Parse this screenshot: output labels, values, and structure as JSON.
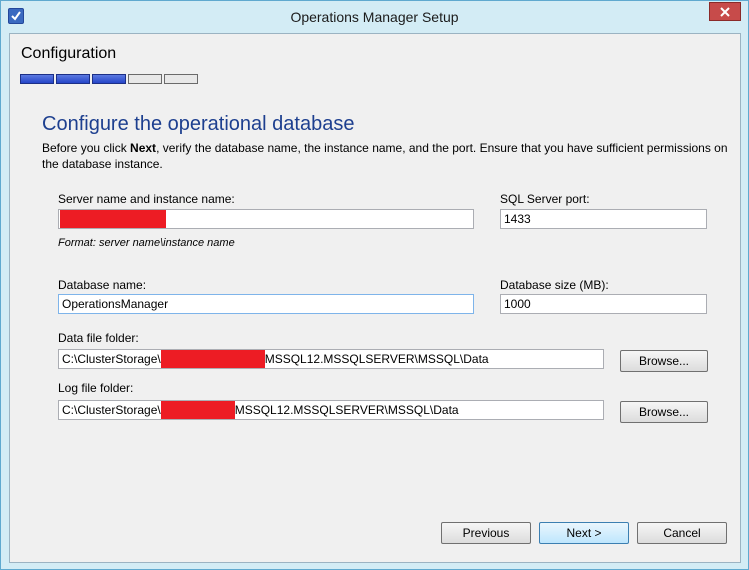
{
  "window": {
    "title": "Operations Manager Setup"
  },
  "header": {
    "title": "Configuration",
    "progress": {
      "total_steps": 5,
      "completed_steps": 3
    }
  },
  "page": {
    "heading": "Configure the operational database",
    "description_pre": "Before you click ",
    "description_bold": "Next",
    "description_post": ", verify the database name, the instance name, and the port. Ensure that you have sufficient permissions on the database instance."
  },
  "form": {
    "server_label": "Server name and instance name:",
    "server_hint": "Format: server name\\instance name",
    "port_label": "SQL Server port:",
    "port_value": "1433",
    "dbname_label": "Database name:",
    "dbname_value": "OperationsManager",
    "dbsize_label": "Database size (MB):",
    "dbsize_value": "1000",
    "datafolder_label": "Data file folder:",
    "datafolder_prefix": "C:\\ClusterStorage\\",
    "datafolder_suffix": "MSSQL12.MSSQLSERVER\\MSSQL\\Data",
    "logfolder_label": "Log file folder:",
    "logfolder_prefix": "C:\\ClusterStorage\\",
    "logfolder_suffix": "MSSQL12.MSSQLSERVER\\MSSQL\\Data",
    "browse_label": "Browse..."
  },
  "buttons": {
    "previous": "Previous",
    "next": "Next >",
    "cancel": "Cancel"
  },
  "colors": {
    "accent": "#1d3f8f",
    "close": "#c74b4a",
    "redaction": "#ed1c24",
    "progress_done": "#2545c8"
  }
}
